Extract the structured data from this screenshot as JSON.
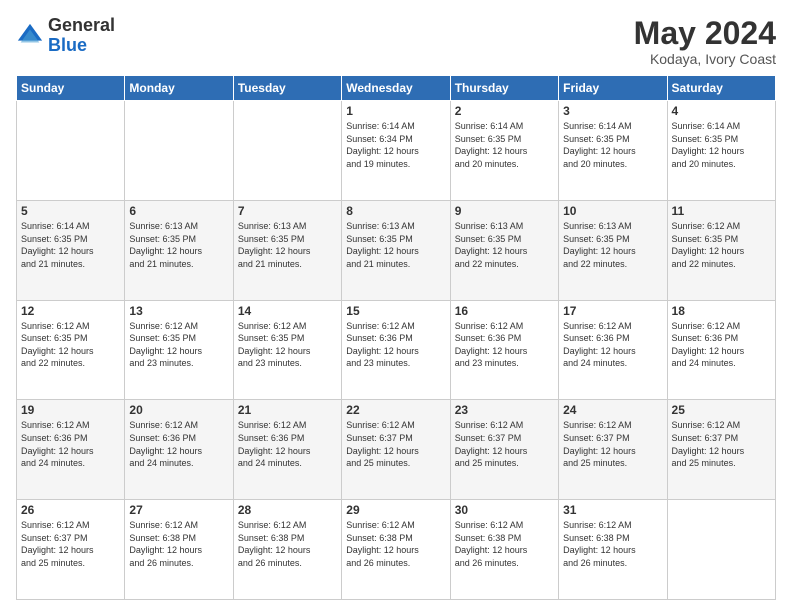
{
  "header": {
    "logo_general": "General",
    "logo_blue": "Blue",
    "month_year": "May 2024",
    "location": "Kodaya, Ivory Coast"
  },
  "weekdays": [
    "Sunday",
    "Monday",
    "Tuesday",
    "Wednesday",
    "Thursday",
    "Friday",
    "Saturday"
  ],
  "weeks": [
    [
      {
        "day": "",
        "info": ""
      },
      {
        "day": "",
        "info": ""
      },
      {
        "day": "",
        "info": ""
      },
      {
        "day": "1",
        "info": "Sunrise: 6:14 AM\nSunset: 6:34 PM\nDaylight: 12 hours\nand 19 minutes."
      },
      {
        "day": "2",
        "info": "Sunrise: 6:14 AM\nSunset: 6:35 PM\nDaylight: 12 hours\nand 20 minutes."
      },
      {
        "day": "3",
        "info": "Sunrise: 6:14 AM\nSunset: 6:35 PM\nDaylight: 12 hours\nand 20 minutes."
      },
      {
        "day": "4",
        "info": "Sunrise: 6:14 AM\nSunset: 6:35 PM\nDaylight: 12 hours\nand 20 minutes."
      }
    ],
    [
      {
        "day": "5",
        "info": "Sunrise: 6:14 AM\nSunset: 6:35 PM\nDaylight: 12 hours\nand 21 minutes."
      },
      {
        "day": "6",
        "info": "Sunrise: 6:13 AM\nSunset: 6:35 PM\nDaylight: 12 hours\nand 21 minutes."
      },
      {
        "day": "7",
        "info": "Sunrise: 6:13 AM\nSunset: 6:35 PM\nDaylight: 12 hours\nand 21 minutes."
      },
      {
        "day": "8",
        "info": "Sunrise: 6:13 AM\nSunset: 6:35 PM\nDaylight: 12 hours\nand 21 minutes."
      },
      {
        "day": "9",
        "info": "Sunrise: 6:13 AM\nSunset: 6:35 PM\nDaylight: 12 hours\nand 22 minutes."
      },
      {
        "day": "10",
        "info": "Sunrise: 6:13 AM\nSunset: 6:35 PM\nDaylight: 12 hours\nand 22 minutes."
      },
      {
        "day": "11",
        "info": "Sunrise: 6:12 AM\nSunset: 6:35 PM\nDaylight: 12 hours\nand 22 minutes."
      }
    ],
    [
      {
        "day": "12",
        "info": "Sunrise: 6:12 AM\nSunset: 6:35 PM\nDaylight: 12 hours\nand 22 minutes."
      },
      {
        "day": "13",
        "info": "Sunrise: 6:12 AM\nSunset: 6:35 PM\nDaylight: 12 hours\nand 23 minutes."
      },
      {
        "day": "14",
        "info": "Sunrise: 6:12 AM\nSunset: 6:35 PM\nDaylight: 12 hours\nand 23 minutes."
      },
      {
        "day": "15",
        "info": "Sunrise: 6:12 AM\nSunset: 6:36 PM\nDaylight: 12 hours\nand 23 minutes."
      },
      {
        "day": "16",
        "info": "Sunrise: 6:12 AM\nSunset: 6:36 PM\nDaylight: 12 hours\nand 23 minutes."
      },
      {
        "day": "17",
        "info": "Sunrise: 6:12 AM\nSunset: 6:36 PM\nDaylight: 12 hours\nand 24 minutes."
      },
      {
        "day": "18",
        "info": "Sunrise: 6:12 AM\nSunset: 6:36 PM\nDaylight: 12 hours\nand 24 minutes."
      }
    ],
    [
      {
        "day": "19",
        "info": "Sunrise: 6:12 AM\nSunset: 6:36 PM\nDaylight: 12 hours\nand 24 minutes."
      },
      {
        "day": "20",
        "info": "Sunrise: 6:12 AM\nSunset: 6:36 PM\nDaylight: 12 hours\nand 24 minutes."
      },
      {
        "day": "21",
        "info": "Sunrise: 6:12 AM\nSunset: 6:36 PM\nDaylight: 12 hours\nand 24 minutes."
      },
      {
        "day": "22",
        "info": "Sunrise: 6:12 AM\nSunset: 6:37 PM\nDaylight: 12 hours\nand 25 minutes."
      },
      {
        "day": "23",
        "info": "Sunrise: 6:12 AM\nSunset: 6:37 PM\nDaylight: 12 hours\nand 25 minutes."
      },
      {
        "day": "24",
        "info": "Sunrise: 6:12 AM\nSunset: 6:37 PM\nDaylight: 12 hours\nand 25 minutes."
      },
      {
        "day": "25",
        "info": "Sunrise: 6:12 AM\nSunset: 6:37 PM\nDaylight: 12 hours\nand 25 minutes."
      }
    ],
    [
      {
        "day": "26",
        "info": "Sunrise: 6:12 AM\nSunset: 6:37 PM\nDaylight: 12 hours\nand 25 minutes."
      },
      {
        "day": "27",
        "info": "Sunrise: 6:12 AM\nSunset: 6:38 PM\nDaylight: 12 hours\nand 26 minutes."
      },
      {
        "day": "28",
        "info": "Sunrise: 6:12 AM\nSunset: 6:38 PM\nDaylight: 12 hours\nand 26 minutes."
      },
      {
        "day": "29",
        "info": "Sunrise: 6:12 AM\nSunset: 6:38 PM\nDaylight: 12 hours\nand 26 minutes."
      },
      {
        "day": "30",
        "info": "Sunrise: 6:12 AM\nSunset: 6:38 PM\nDaylight: 12 hours\nand 26 minutes."
      },
      {
        "day": "31",
        "info": "Sunrise: 6:12 AM\nSunset: 6:38 PM\nDaylight: 12 hours\nand 26 minutes."
      },
      {
        "day": "",
        "info": ""
      }
    ]
  ]
}
